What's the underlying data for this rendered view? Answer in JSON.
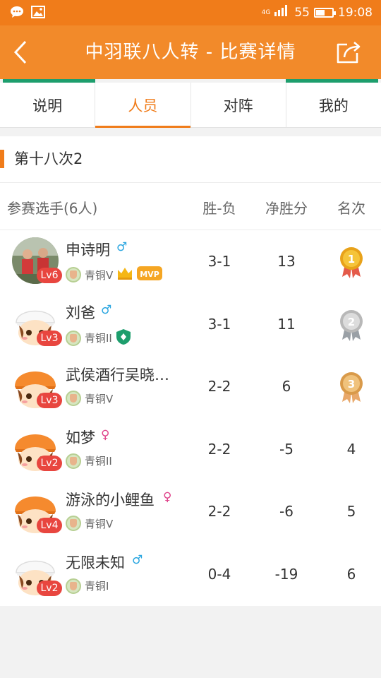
{
  "status_bar": {
    "network": "4G",
    "battery": "55",
    "battery_fraction": 0.55,
    "time": "19:08",
    "left_icons": [
      "chat-bubble-icon",
      "image-icon"
    ]
  },
  "header": {
    "title": "中羽联八人转 - 比赛详情",
    "back_icon": "chevron-left-icon",
    "share_icon": "share-icon"
  },
  "tabs": [
    {
      "label": "说明",
      "active": false
    },
    {
      "label": "人员",
      "active": true
    },
    {
      "label": "对阵",
      "active": false
    },
    {
      "label": "我的",
      "active": false
    }
  ],
  "round": {
    "title": "第十八次2"
  },
  "table": {
    "headers": {
      "player": "参赛选手(6人)",
      "wl": "胜-负",
      "net": "净胜分",
      "rank": "名次"
    },
    "rows": [
      {
        "name": "申诗明",
        "gender": "♂",
        "level": "Lv6",
        "tier": "青铜V",
        "wl": "3-1",
        "net": "13",
        "rank": "1",
        "badges": [
          "crown-icon",
          "mvp-badge"
        ],
        "avatar": "photo"
      },
      {
        "name": "刘爸",
        "gender": "♂",
        "level": "Lv3",
        "tier": "青铜II",
        "wl": "3-1",
        "net": "11",
        "rank": "2",
        "badges": [
          "shield-icon"
        ],
        "avatar": "white-hat"
      },
      {
        "name": "武侯酒行吴晓…",
        "gender": "",
        "level": "Lv3",
        "tier": "青铜V",
        "wl": "2-2",
        "net": "6",
        "rank": "3",
        "badges": [],
        "avatar": "orange-hat"
      },
      {
        "name": "如梦",
        "gender": "♀",
        "level": "Lv2",
        "tier": "青铜II",
        "wl": "2-2",
        "net": "-5",
        "rank": "4",
        "badges": [],
        "avatar": "orange-hat"
      },
      {
        "name": "游泳的小鲤鱼",
        "gender": "♀",
        "level": "Lv4",
        "tier": "青铜V",
        "wl": "2-2",
        "net": "-6",
        "rank": "5",
        "badges": [],
        "avatar": "orange-hat"
      },
      {
        "name": "无限未知",
        "gender": "♂",
        "level": "Lv2",
        "tier": "青铜I",
        "wl": "0-4",
        "net": "-19",
        "rank": "6",
        "badges": [],
        "avatar": "white-hat"
      }
    ]
  },
  "colors": {
    "brand": "#f07c1a",
    "accent_green": "#1d9e6d",
    "level_red": "#e8463f",
    "male": "#2aa6e0",
    "female": "#e0458c"
  }
}
